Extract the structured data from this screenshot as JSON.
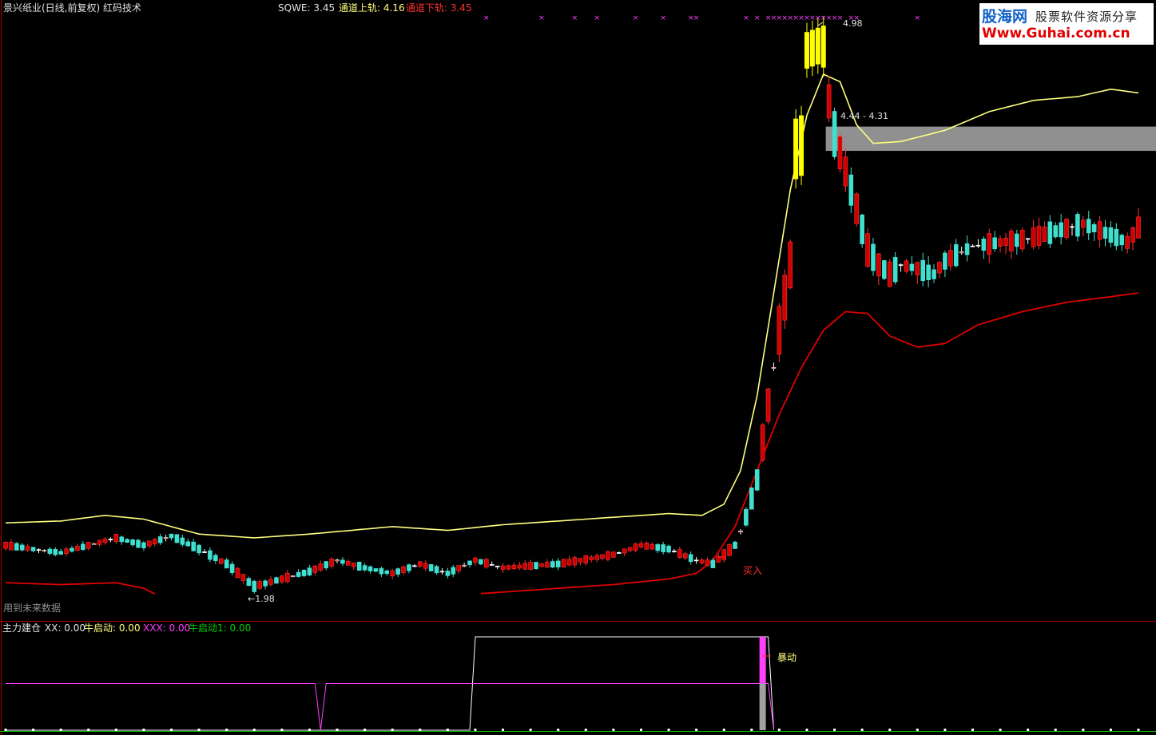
{
  "header": {
    "title": "景兴纸业(日线,前复权) 红码技术",
    "sqwe_label": "SQWE: 3.45",
    "upper_label": "通道上轨: 4.16",
    "lower_label": "通道下轨: 3.45"
  },
  "annotations": {
    "high_label": "4.98",
    "zone_label": "4.44 - 4.31",
    "low_label": "←1.98",
    "buy_label": "买入",
    "future_note": "用到未来数据",
    "surge_label": "暴动"
  },
  "sub_header": {
    "name": "主力建仓",
    "xx": "XX: 0.00",
    "niu": "牛启动: 0.00",
    "xxx": "XXX: 0.00",
    "niu1": "牛启动1: 0.00"
  },
  "logo": {
    "main": "股海网",
    "tagline": "股票软件资源分享",
    "url": "Www.Guhai.com.cn"
  },
  "colors": {
    "up": "#ff3030",
    "up_fill": "#d00000",
    "down": "#3fe0d0",
    "upper_band": "#ffff80",
    "lower_band": "#e00000",
    "highlight": "#ffff00",
    "magenta": "#ff40ff",
    "white": "#ffffff",
    "gray": "#a0a0a0",
    "green": "#00c000"
  },
  "chart_data": {
    "type": "candlestick",
    "bars": 206,
    "ylim": [
      1.8,
      5.1
    ],
    "price_path": [
      [
        0,
        2.2
      ],
      [
        10,
        2.16
      ],
      [
        20,
        2.24
      ],
      [
        25,
        2.2
      ],
      [
        30,
        2.25
      ],
      [
        35,
        2.18
      ],
      [
        40,
        2.1
      ],
      [
        45,
        1.98
      ],
      [
        50,
        2.02
      ],
      [
        55,
        2.06
      ],
      [
        60,
        2.12
      ],
      [
        65,
        2.08
      ],
      [
        70,
        2.05
      ],
      [
        75,
        2.1
      ],
      [
        80,
        2.05
      ],
      [
        85,
        2.12
      ],
      [
        90,
        2.08
      ],
      [
        100,
        2.1
      ],
      [
        110,
        2.15
      ],
      [
        115,
        2.2
      ],
      [
        120,
        2.18
      ],
      [
        125,
        2.12
      ],
      [
        128,
        2.1
      ],
      [
        130,
        2.15
      ],
      [
        132,
        2.2
      ],
      [
        134,
        2.35
      ],
      [
        136,
        2.55
      ],
      [
        138,
        2.95
      ],
      [
        140,
        3.35
      ],
      [
        142,
        3.7
      ],
      [
        144,
        4.1
      ],
      [
        146,
        4.55
      ],
      [
        148,
        4.75
      ],
      [
        150,
        4.4
      ],
      [
        152,
        4.2
      ],
      [
        154,
        4.0
      ],
      [
        156,
        3.78
      ],
      [
        158,
        3.7
      ],
      [
        160,
        3.65
      ],
      [
        162,
        3.7
      ],
      [
        165,
        3.68
      ],
      [
        168,
        3.65
      ],
      [
        170,
        3.72
      ],
      [
        175,
        3.8
      ],
      [
        180,
        3.82
      ],
      [
        185,
        3.84
      ],
      [
        190,
        3.88
      ],
      [
        195,
        3.92
      ],
      [
        200,
        3.86
      ],
      [
        203,
        3.82
      ],
      [
        205,
        3.9
      ]
    ],
    "upper_band_path": [
      [
        0,
        2.32
      ],
      [
        10,
        2.33
      ],
      [
        18,
        2.36
      ],
      [
        25,
        2.34
      ],
      [
        35,
        2.26
      ],
      [
        45,
        2.24
      ],
      [
        55,
        2.26
      ],
      [
        70,
        2.3
      ],
      [
        80,
        2.28
      ],
      [
        90,
        2.31
      ],
      [
        100,
        2.33
      ],
      [
        110,
        2.35
      ],
      [
        120,
        2.37
      ],
      [
        126,
        2.36
      ],
      [
        130,
        2.42
      ],
      [
        133,
        2.6
      ],
      [
        136,
        3.0
      ],
      [
        139,
        3.55
      ],
      [
        142,
        4.1
      ],
      [
        145,
        4.5
      ],
      [
        148,
        4.72
      ],
      [
        151,
        4.68
      ],
      [
        154,
        4.45
      ],
      [
        157,
        4.35
      ],
      [
        162,
        4.36
      ],
      [
        170,
        4.42
      ],
      [
        178,
        4.52
      ],
      [
        186,
        4.58
      ],
      [
        194,
        4.6
      ],
      [
        200,
        4.64
      ],
      [
        205,
        4.62
      ]
    ],
    "lower_band_path": [
      [
        0,
        2.0
      ],
      [
        10,
        1.99
      ],
      [
        20,
        2.0
      ],
      [
        25,
        1.97
      ],
      [
        27,
        1.94
      ],
      [
        80,
        1.93
      ],
      [
        90,
        1.95
      ],
      [
        100,
        1.97
      ],
      [
        110,
        1.99
      ],
      [
        120,
        2.02
      ],
      [
        125,
        2.05
      ],
      [
        128,
        2.12
      ],
      [
        132,
        2.3
      ],
      [
        136,
        2.6
      ],
      [
        140,
        2.9
      ],
      [
        144,
        3.15
      ],
      [
        148,
        3.35
      ],
      [
        152,
        3.45
      ],
      [
        156,
        3.44
      ],
      [
        160,
        3.32
      ],
      [
        165,
        3.26
      ],
      [
        170,
        3.28
      ],
      [
        176,
        3.38
      ],
      [
        184,
        3.45
      ],
      [
        192,
        3.5
      ],
      [
        200,
        3.53
      ],
      [
        205,
        3.55
      ]
    ],
    "lower_band_gap": [
      27,
      86
    ],
    "highlight_bars": [
      {
        "from": 143,
        "to": 144,
        "lo": 4.15,
        "hi": 4.5
      },
      {
        "from": 145,
        "to": 148,
        "lo": 4.75,
        "hi": 4.98
      }
    ],
    "high_point": {
      "bar": 147,
      "value": 4.98
    },
    "zone": {
      "from_bar": 149,
      "lo": 4.31,
      "hi": 4.44
    },
    "low_point": {
      "bar": 43,
      "value": 1.98
    },
    "buy_point": {
      "bar": 131,
      "value": 2.12
    },
    "x_markers": [
      87,
      97,
      103,
      107,
      114,
      119,
      124,
      125,
      134,
      136,
      138,
      139,
      140,
      141,
      142,
      143,
      144,
      145,
      146,
      147,
      148,
      149,
      150,
      151,
      153,
      154,
      165
    ],
    "indicator": {
      "name": "主力建仓",
      "ylim": [
        0,
        2
      ],
      "xx_step": [
        [
          0,
          0
        ],
        [
          84,
          0
        ],
        [
          85,
          2
        ],
        [
          138,
          2
        ],
        [
          139,
          0
        ]
      ],
      "xxx_line": [
        [
          0,
          1
        ],
        [
          56,
          1
        ],
        [
          57,
          0
        ],
        [
          58,
          1
        ],
        [
          138,
          1
        ],
        [
          139,
          0
        ]
      ],
      "surge_bar": 137,
      "surge_pink": [
        1,
        2
      ],
      "surge_gray": [
        0,
        1
      ],
      "xx_value": 0.0,
      "niu_value": 0.0,
      "xxx_value": 0.0,
      "niu1_value": 0.0
    }
  }
}
